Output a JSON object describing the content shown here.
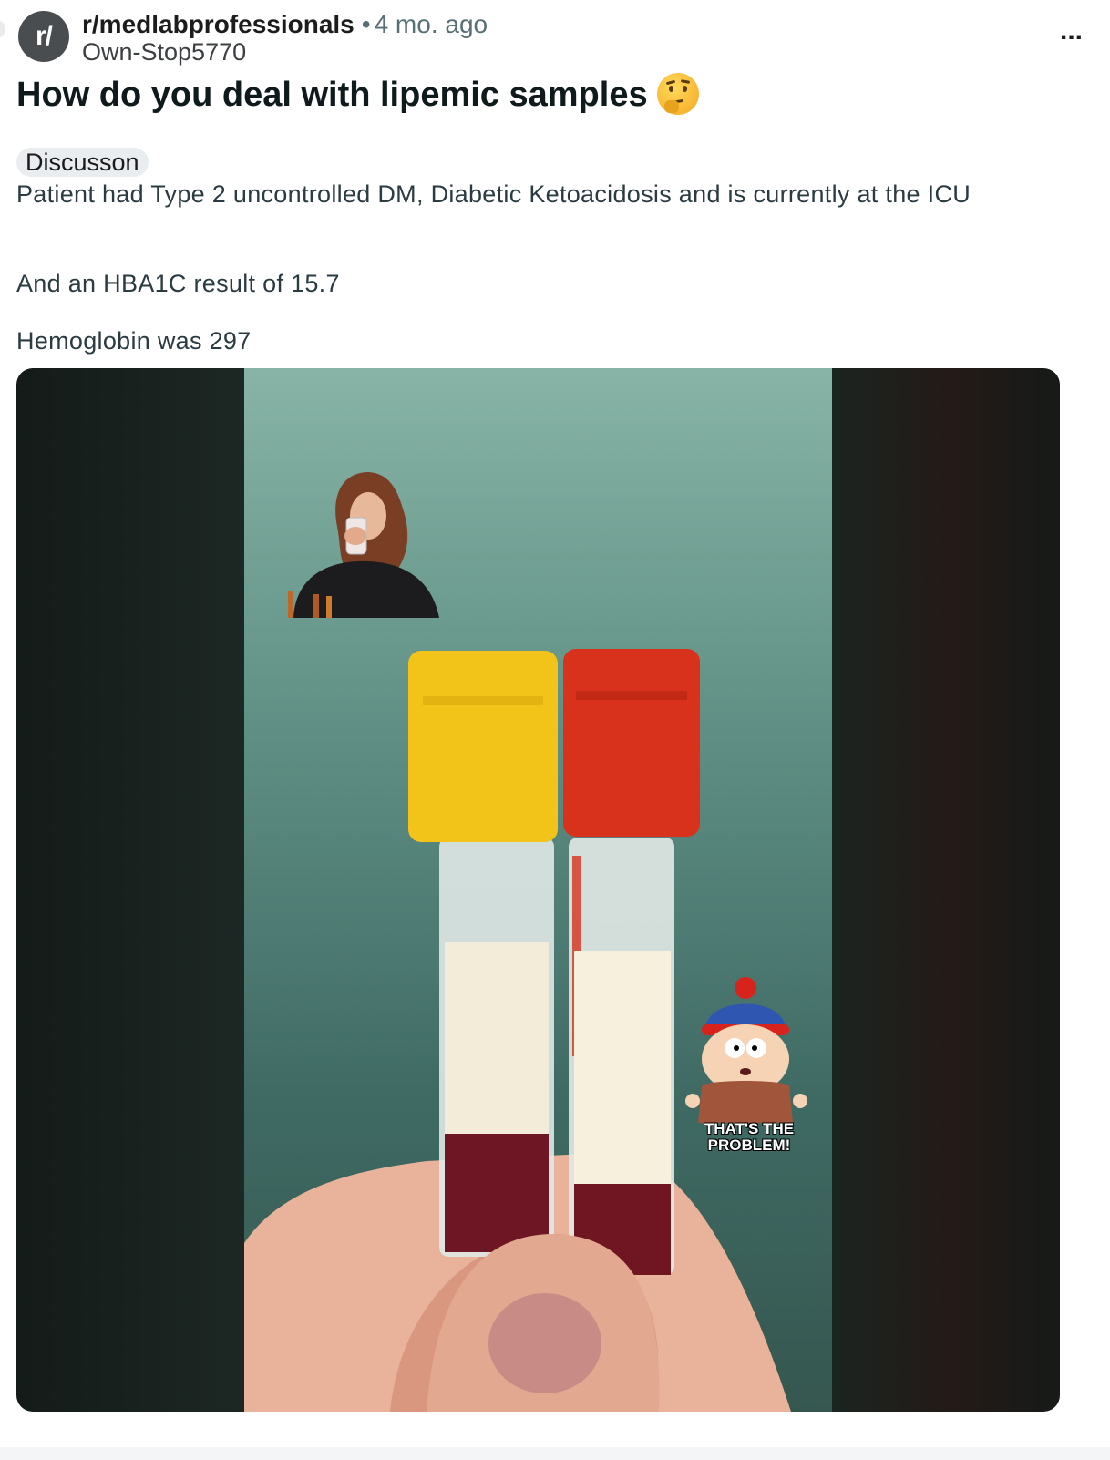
{
  "post": {
    "subreddit_icon_text": "r/",
    "subreddit": "r/medlabprofessionals",
    "separator": "•",
    "age": "4 mo. ago",
    "author": "Own-Stop5770",
    "more_label": "...",
    "title": "How do you deal with lipemic samples",
    "title_emoji": "thinking-face-emoji",
    "flair": "Discusson",
    "body": [
      "Patient had Type 2 uncontrolled DM, Diabetic Ketoacidosis and is currently at the ICU",
      "And an HBA1C result of 15.7",
      "Hemoglobin was 297"
    ]
  },
  "media": {
    "sticker_caption_line1": "THAT'S THE",
    "sticker_caption_line2": "PROBLEM!",
    "tube_left_cap_color": "#f2c318",
    "tube_right_cap_color": "#d8311c"
  }
}
